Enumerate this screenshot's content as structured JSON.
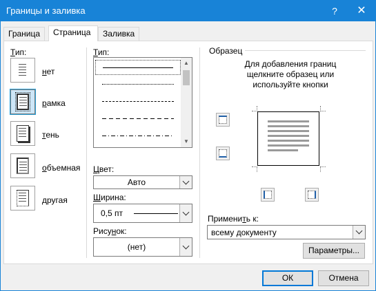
{
  "window": {
    "title": "Границы и заливка",
    "help": "?",
    "close": "✕"
  },
  "tabs": [
    {
      "label": "Граница",
      "active": false
    },
    {
      "label": "Страница",
      "active": true
    },
    {
      "label": "Заливка",
      "active": false
    }
  ],
  "setting": {
    "label_prefix": "",
    "label_u": "Т",
    "label_rest": "ип:",
    "presets": [
      {
        "pre": "",
        "u": "н",
        "post": "ет",
        "icon": "no-border-icon"
      },
      {
        "pre": "",
        "u": "р",
        "post": "амка",
        "icon": "box-border-icon",
        "selected": true
      },
      {
        "pre": "",
        "u": "т",
        "post": "ень",
        "icon": "shadow-border-icon"
      },
      {
        "pre": "",
        "u": "о",
        "post": "бъемная",
        "icon": "3d-border-icon"
      },
      {
        "pre": "",
        "u": "д",
        "post": "ругая",
        "icon": "custom-border-icon"
      }
    ]
  },
  "style": {
    "label_pre": "",
    "label_u": "Т",
    "label_post": "ип:",
    "items": [
      "solid",
      "dotted",
      "dashed-small",
      "dashed-large",
      "dash-dot"
    ]
  },
  "color": {
    "label_pre": "",
    "label_u": "Ц",
    "label_post": "вет:",
    "value": "Авто"
  },
  "width": {
    "label_pre": "",
    "label_u": "Ш",
    "label_post": "ирина:",
    "value": "0,5 пт"
  },
  "art": {
    "label_pre": "Рису",
    "label_u": "н",
    "label_post": "ок:",
    "value": "(нет)"
  },
  "preview": {
    "label": "Образец",
    "hint": "Для добавления границ щелкните образец или используйте кнопки"
  },
  "apply_to": {
    "label_pre": "Примени",
    "label_u": "т",
    "label_post": "ь к:",
    "value": "всему документу"
  },
  "buttons": {
    "options": "Параметры...",
    "ok": "ОК",
    "cancel": "Отмена"
  },
  "colors": {
    "accent": "#1883d7",
    "selection": "#cde6f7"
  }
}
